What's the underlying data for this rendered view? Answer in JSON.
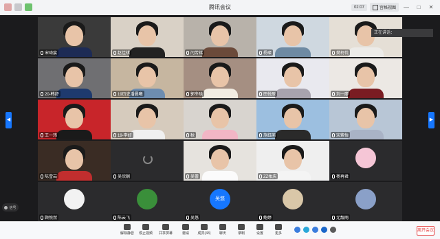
{
  "app": {
    "title": "腾讯会议",
    "timer": "02:07",
    "view_label": "宫格视图"
  },
  "speaking_indicator": "正在讲话：",
  "signal_label": "信号",
  "participants": [
    {
      "name": "宋琦宸",
      "kind": "video",
      "bg": "#3a3a3a",
      "shirt": "#1d2b55"
    },
    {
      "name": "赵佳祺",
      "kind": "video",
      "bg": "#d9d1c6",
      "shirt": "#222222"
    },
    {
      "name": "闫芳铭",
      "kind": "video",
      "bg": "#b8b2aa",
      "shirt": "#6b4a3a"
    },
    {
      "name": "杨璨",
      "kind": "video",
      "bg": "#cfd8e0",
      "shirt": "#6e8aa3"
    },
    {
      "name": "樊柯伐",
      "kind": "video",
      "bg": "#e5dfd6",
      "shirt": "#ecebe8"
    },
    {
      "name": "20-韩舒",
      "kind": "video",
      "bg": "#6f6f72",
      "shirt": "#1e3a6e"
    },
    {
      "name": "19历史潘晨曦",
      "kind": "video",
      "bg": "#c6b6a0",
      "shirt": "#6d8db0"
    },
    {
      "name": "郭冬晗",
      "kind": "video",
      "bg": "#a58f82",
      "shirt": "#f2ece2"
    },
    {
      "name": "田悦辰",
      "kind": "video",
      "bg": "#e9e9ef",
      "shirt": "#a8a3ae"
    },
    {
      "name": "刘一廖",
      "kind": "video",
      "bg": "#ece8e4",
      "shirt": "#7a1c22"
    },
    {
      "name": "王一玮",
      "kind": "video",
      "bg": "#c8252a",
      "shirt": "#1a1a1a"
    },
    {
      "name": "19-李好",
      "kind": "video",
      "bg": "#d6cbbd",
      "shirt": "#f0f0f0"
    },
    {
      "name": "秋",
      "kind": "video",
      "bg": "#d8d4cf",
      "shirt": "#f2b6c5"
    },
    {
      "name": "施鈺菡",
      "kind": "video",
      "bg": "#9cbfe0",
      "shirt": "#2a2a2a"
    },
    {
      "name": "宋紫怡",
      "kind": "video",
      "bg": "#b8c6d6",
      "shirt": "#a9b3c6"
    },
    {
      "name": "陈雪岩",
      "kind": "video",
      "bg": "#3a2c24",
      "shirt": "#c12e2e"
    },
    {
      "name": "吴欣娴",
      "kind": "loading",
      "bg": "#2b2b2d"
    },
    {
      "name": "吴蕾",
      "kind": "video",
      "bg": "#e6e3de",
      "shirt": "#fbfbfb"
    },
    {
      "name": "ZZ佑庆",
      "kind": "video",
      "bg": "#efefef",
      "shirt": "#f4f4f4"
    },
    {
      "name": "杨再君",
      "kind": "avatar",
      "bg": "#2b2b2d",
      "avatar_color": "#f5c6d6"
    },
    {
      "name": "顾悦然",
      "kind": "avatar",
      "bg": "#2b2b2d",
      "avatar_color": "#f2f2f2"
    },
    {
      "name": "陈云飞",
      "kind": "avatar",
      "bg": "#2b2b2d",
      "avatar_color": "#3a8f3a"
    },
    {
      "name": "吴悠",
      "kind": "avatar-text",
      "bg": "#2b2b2d",
      "avatar_color": "#1677ff",
      "avatar_text": "吴悠"
    },
    {
      "name": "鲍婷",
      "kind": "avatar",
      "bg": "#2b2b2d",
      "avatar_color": "#d9c7a8"
    },
    {
      "name": "尤靓雨",
      "kind": "avatar",
      "bg": "#2b2b2d",
      "avatar_color": "#8aa0c8"
    }
  ],
  "toolbar": [
    {
      "label": "解除静音",
      "icon": "microphone-icon"
    },
    {
      "label": "停止视频",
      "icon": "camera-icon"
    },
    {
      "label": "共享屏幕",
      "icon": "share-screen-icon"
    },
    {
      "label": "邀请",
      "icon": "invite-icon"
    },
    {
      "label": "成员(43)",
      "icon": "members-icon"
    },
    {
      "label": "聊天",
      "icon": "chat-icon"
    },
    {
      "label": "录制",
      "icon": "record-icon"
    },
    {
      "label": "设置",
      "icon": "settings-icon"
    },
    {
      "label": "更多",
      "icon": "more-icon"
    }
  ],
  "leave_label": "离开会议"
}
